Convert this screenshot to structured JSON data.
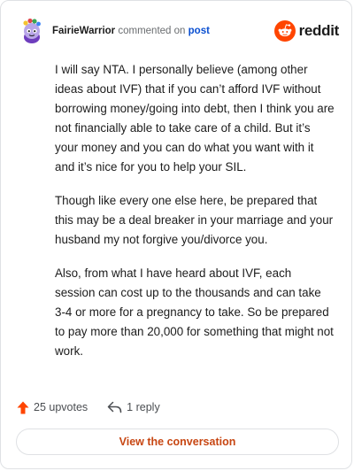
{
  "comment": {
    "username": "FairieWarrior",
    "verb": "commented on",
    "post_link": "post",
    "paragraphs": [
      "I will say NTA. I personally believe (among other ideas about IVF) that if you can’t afford IVF without borrowing money/going into debt, then I think you are not financially able to take care of a child. But it’s your money and you can do what you want with it and it’s nice for you to help your SIL.",
      "Though like every one else here, be prepared that this may be a deal breaker in your marriage and your husband my not forgive you/divorce you.",
      "Also, from what I have heard about IVF, each session can cost up to the thousands and can take 3-4 or more for a pregnancy to take. So be prepared to pay more than 20,000 for something that might not work."
    ],
    "upvotes": "25 upvotes",
    "replies": "1 reply"
  },
  "brand": {
    "name": "reddit",
    "color": "#ff4500"
  },
  "footer": {
    "cta": "View the conversation"
  },
  "icons": {
    "avatar": "avatar-icon",
    "brand": "reddit-logo-icon",
    "upvote": "upvote-arrow-icon",
    "reply": "reply-arrow-icon"
  },
  "colors": {
    "link": "#0a4fd1",
    "upvote": "#ff4500",
    "cta_text": "#c74612",
    "border": "#dfe1e4"
  }
}
